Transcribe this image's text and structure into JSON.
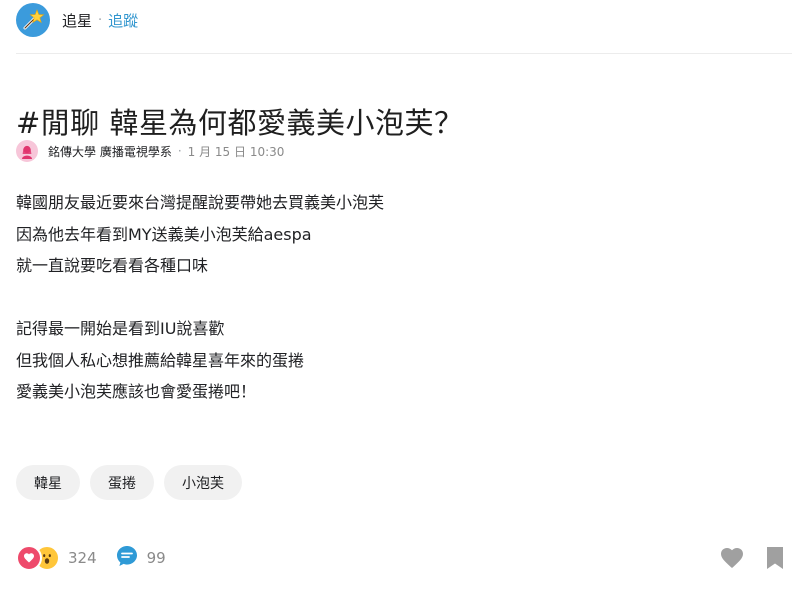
{
  "board": {
    "name": "追星",
    "separator": "·",
    "follow_label": "追蹤"
  },
  "post": {
    "title": "#閒聊 韓星為何都愛義美小泡芙？",
    "author": "銘傳大學 廣播電視學系",
    "meta_separator": "·",
    "time": "1 月 15 日 10:30",
    "body_lines": [
      "韓國朋友最近要來台灣提醒說要帶她去買義美小泡芙",
      "因為他去年看到MY送義美小泡芙給aespa",
      "就一直說要吃看看各種口味",
      "",
      "記得最一開始是看到IU說喜歡",
      "但我個人私心想推薦給韓星喜年來的蛋捲",
      "愛義美小泡芙應該也會愛蛋捲吧！"
    ],
    "tags": [
      "韓星",
      "蛋捲",
      "小泡芙"
    ]
  },
  "footer": {
    "like_count": "324",
    "comment_count": "99"
  },
  "icons": {
    "board_avatar": "magic-wand-icon",
    "author_avatar": "female-avatar-icon",
    "reaction_heart": "heart-reaction-icon",
    "reaction_wow": "wow-reaction-icon",
    "comment": "comment-bubble-icon",
    "like_button": "heart-icon",
    "bookmark_button": "bookmark-icon"
  },
  "colors": {
    "accent": "#3397cf",
    "board_avatar_bg": "#3b9bdc",
    "heart": "#ee4a6b",
    "wow": "#ffc63a",
    "comment": "#2f9ad6",
    "muted_text": "#8a8a8a",
    "tag_bg": "#f1f1f1",
    "action_icon": "#a0a0a0"
  }
}
